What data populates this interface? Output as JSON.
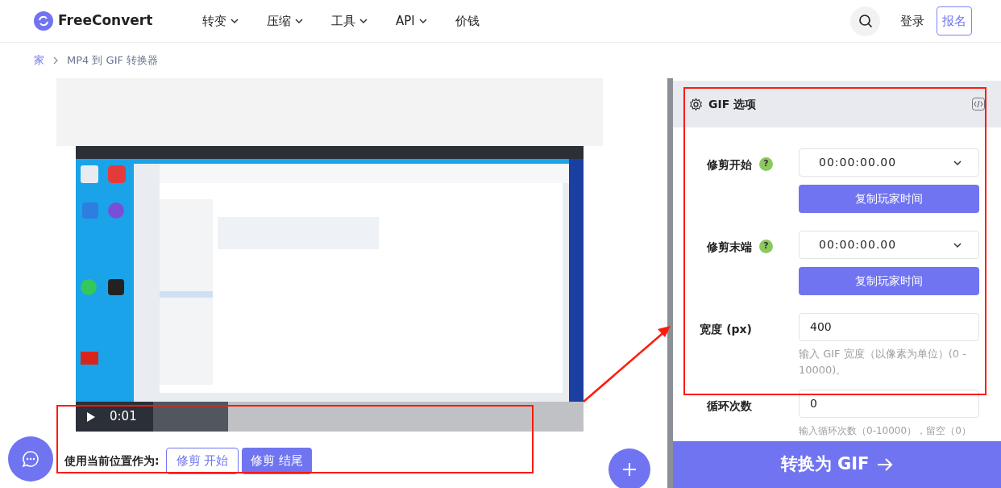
{
  "header": {
    "logo": "FreeConvert",
    "nav": [
      {
        "label": "转变",
        "dropdown": true
      },
      {
        "label": "压缩",
        "dropdown": true
      },
      {
        "label": "工具",
        "dropdown": true
      },
      {
        "label": "API",
        "dropdown": true
      },
      {
        "label": "价钱",
        "dropdown": false
      }
    ],
    "login": "登录",
    "signup": "报名"
  },
  "breadcrumb": [
    "家",
    "MP4 到 GIF 转换器"
  ],
  "player": {
    "time": "0:01",
    "level": 0.3
  },
  "trim": {
    "label": "使用当前位置作为:",
    "buttons": [
      {
        "label": "修剪 开始",
        "selected": false
      },
      {
        "label": "修剪 结尾",
        "selected": true
      }
    ]
  },
  "options": {
    "title": "GIF 选项",
    "fields": [
      {
        "kind": "time",
        "label": "修剪开始",
        "help": "?",
        "value": "00:00:00.00",
        "button": "复制玩家时间"
      },
      {
        "kind": "time",
        "label": "修剪末端",
        "help": "?",
        "value": "00:00:00.00",
        "button": "复制玩家时间"
      },
      {
        "kind": "number",
        "label": "宽度 (px)",
        "value": "400",
        "hint": "输入 GIF 宽度（以像素为单位）(0 - 10000)。"
      },
      {
        "kind": "number",
        "label": "循环次数",
        "value": "0",
        "hint": "输入循环次数（0-10000），留空（0）"
      }
    ],
    "convert": "转换为 GIF"
  }
}
